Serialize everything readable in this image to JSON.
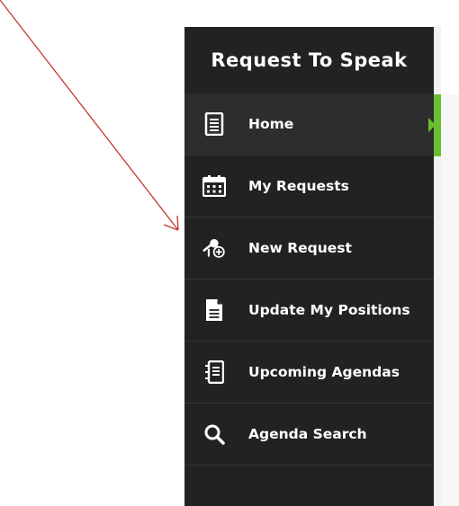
{
  "sidebar": {
    "title": "Request To Speak",
    "items": [
      {
        "label": "Home",
        "icon": "home-document-icon",
        "active": true
      },
      {
        "label": "My Requests",
        "icon": "calendar-icon",
        "active": false
      },
      {
        "label": "New Request",
        "icon": "microphone-add-icon",
        "active": false
      },
      {
        "label": "Update My Positions",
        "icon": "document-icon",
        "active": false
      },
      {
        "label": "Upcoming Agendas",
        "icon": "notebook-icon",
        "active": false
      },
      {
        "label": "Agenda Search",
        "icon": "search-icon",
        "active": false
      }
    ]
  },
  "colors": {
    "sidebar_bg": "#222222",
    "active_bg": "#2d2d2d",
    "accent": "#6abf2e",
    "annotation": "#c0392b"
  }
}
